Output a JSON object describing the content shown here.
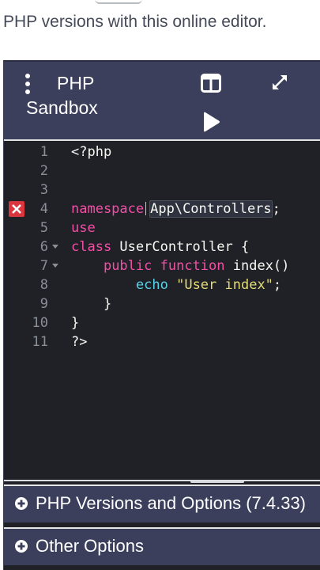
{
  "intro_text": "PHP versions with this online editor.",
  "header": {
    "title_line1": "PHP",
    "title_line2": "Sandbox"
  },
  "icons": {
    "menu": "kebab-menu-icon",
    "layout": "split-layout-icon",
    "expand": "expand-icon",
    "run": "play-icon",
    "error": "error-marker-icon",
    "add": "plus-circle-icon"
  },
  "editor": {
    "lines": [
      {
        "n": "1",
        "tokens": [
          {
            "t": "<?php",
            "c": "plain"
          }
        ]
      },
      {
        "n": "2",
        "tokens": []
      },
      {
        "n": "3",
        "tokens": []
      },
      {
        "n": "4",
        "error": true,
        "tokens": [
          {
            "t": "namespace",
            "c": "kw"
          },
          {
            "t": "App\\Controllers",
            "c": "ns"
          },
          {
            "t": ";",
            "c": "plain"
          }
        ]
      },
      {
        "n": "5",
        "tokens": [
          {
            "t": "use",
            "c": "kw"
          }
        ]
      },
      {
        "n": "6",
        "fold": true,
        "tokens": [
          {
            "t": "class",
            "c": "kw"
          },
          {
            "t": " UserController {",
            "c": "plain"
          }
        ]
      },
      {
        "n": "7",
        "fold": true,
        "tokens": [
          {
            "t": "    ",
            "c": "plain"
          },
          {
            "t": "public",
            "c": "kw"
          },
          {
            "t": " ",
            "c": "plain"
          },
          {
            "t": "function",
            "c": "kw"
          },
          {
            "t": " index()",
            "c": "plain"
          }
        ]
      },
      {
        "n": "8",
        "tokens": [
          {
            "t": "        ",
            "c": "plain"
          },
          {
            "t": "echo",
            "c": "fn"
          },
          {
            "t": " ",
            "c": "plain"
          },
          {
            "t": "\"User index\"",
            "c": "str"
          },
          {
            "t": ";",
            "c": "plain"
          }
        ]
      },
      {
        "n": "9",
        "tokens": [
          {
            "t": "    }",
            "c": "plain"
          }
        ]
      },
      {
        "n": "10",
        "tokens": [
          {
            "t": "}",
            "c": "plain"
          }
        ]
      },
      {
        "n": "11",
        "tokens": [
          {
            "t": "?>",
            "c": "plain"
          }
        ]
      }
    ]
  },
  "sections": {
    "versions_label": "PHP Versions and Options (7.4.33)",
    "other_label": "Other Options"
  },
  "colors": {
    "header_bg": "#3b3f5c",
    "editor_bg": "#1f2127",
    "keyword": "#f24fa5",
    "function": "#5ad1e6",
    "string": "#e6db74",
    "error": "#d9363e"
  }
}
